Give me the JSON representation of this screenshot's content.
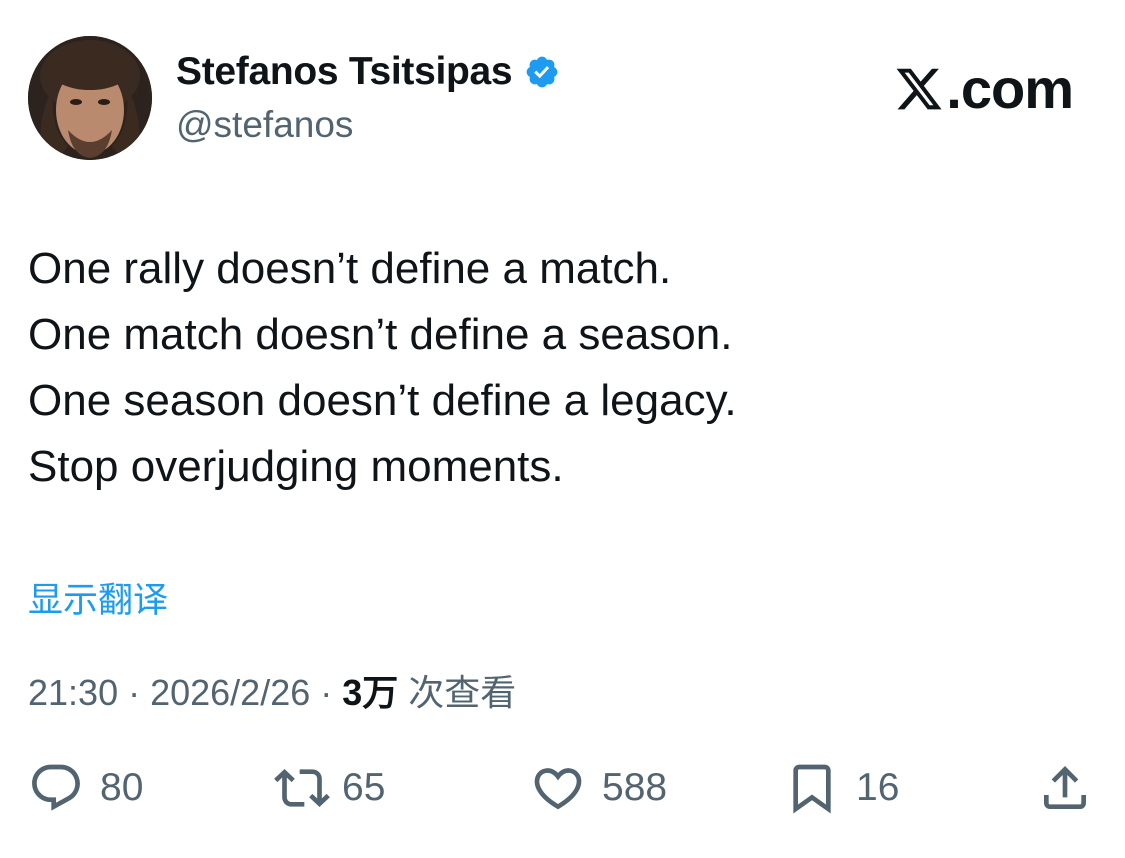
{
  "author": {
    "display_name": "Stefanos Tsitsipas",
    "handle": "@stefanos",
    "verified": true,
    "badge_color": "#1d9bf0"
  },
  "brand": {
    "text": ".com",
    "logo_icon": "x-logo-icon"
  },
  "tweet": {
    "lines": [
      "One rally doesn’t define a match.",
      "One match doesn’t define a season.",
      "One season doesn’t define a legacy.",
      "Stop overjudging moments."
    ],
    "translate_label": "显示翻译"
  },
  "meta": {
    "time": "21:30",
    "separator": " · ",
    "date": "2026/2/26",
    "views_count": "3万",
    "views_label": " 次查看"
  },
  "actions": {
    "reply": {
      "icon": "reply-icon",
      "count": "80"
    },
    "retweet": {
      "icon": "retweet-icon",
      "count": "65"
    },
    "like": {
      "icon": "heart-icon",
      "count": "588"
    },
    "bookmark": {
      "icon": "bookmark-icon",
      "count": "16"
    },
    "share": {
      "icon": "share-icon"
    }
  },
  "colors": {
    "text_primary": "#0f1419",
    "text_secondary": "#536471",
    "accent": "#1d9bf0"
  }
}
